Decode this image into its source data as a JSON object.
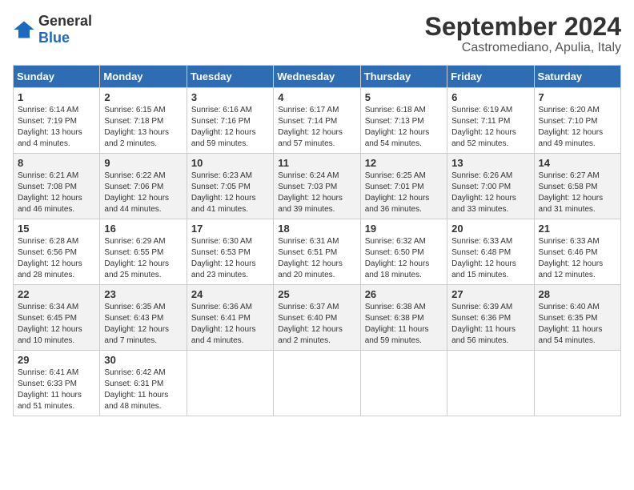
{
  "logo": {
    "general": "General",
    "blue": "Blue"
  },
  "header": {
    "month_year": "September 2024",
    "location": "Castromediano, Apulia, Italy"
  },
  "weekdays": [
    "Sunday",
    "Monday",
    "Tuesday",
    "Wednesday",
    "Thursday",
    "Friday",
    "Saturday"
  ],
  "days": [
    {
      "number": "1",
      "sunrise": "6:14 AM",
      "sunset": "7:19 PM",
      "daylight": "13 hours and 4 minutes."
    },
    {
      "number": "2",
      "sunrise": "6:15 AM",
      "sunset": "7:18 PM",
      "daylight": "13 hours and 2 minutes."
    },
    {
      "number": "3",
      "sunrise": "6:16 AM",
      "sunset": "7:16 PM",
      "daylight": "12 hours and 59 minutes."
    },
    {
      "number": "4",
      "sunrise": "6:17 AM",
      "sunset": "7:14 PM",
      "daylight": "12 hours and 57 minutes."
    },
    {
      "number": "5",
      "sunrise": "6:18 AM",
      "sunset": "7:13 PM",
      "daylight": "12 hours and 54 minutes."
    },
    {
      "number": "6",
      "sunrise": "6:19 AM",
      "sunset": "7:11 PM",
      "daylight": "12 hours and 52 minutes."
    },
    {
      "number": "7",
      "sunrise": "6:20 AM",
      "sunset": "7:10 PM",
      "daylight": "12 hours and 49 minutes."
    },
    {
      "number": "8",
      "sunrise": "6:21 AM",
      "sunset": "7:08 PM",
      "daylight": "12 hours and 46 minutes."
    },
    {
      "number": "9",
      "sunrise": "6:22 AM",
      "sunset": "7:06 PM",
      "daylight": "12 hours and 44 minutes."
    },
    {
      "number": "10",
      "sunrise": "6:23 AM",
      "sunset": "7:05 PM",
      "daylight": "12 hours and 41 minutes."
    },
    {
      "number": "11",
      "sunrise": "6:24 AM",
      "sunset": "7:03 PM",
      "daylight": "12 hours and 39 minutes."
    },
    {
      "number": "12",
      "sunrise": "6:25 AM",
      "sunset": "7:01 PM",
      "daylight": "12 hours and 36 minutes."
    },
    {
      "number": "13",
      "sunrise": "6:26 AM",
      "sunset": "7:00 PM",
      "daylight": "12 hours and 33 minutes."
    },
    {
      "number": "14",
      "sunrise": "6:27 AM",
      "sunset": "6:58 PM",
      "daylight": "12 hours and 31 minutes."
    },
    {
      "number": "15",
      "sunrise": "6:28 AM",
      "sunset": "6:56 PM",
      "daylight": "12 hours and 28 minutes."
    },
    {
      "number": "16",
      "sunrise": "6:29 AM",
      "sunset": "6:55 PM",
      "daylight": "12 hours and 25 minutes."
    },
    {
      "number": "17",
      "sunrise": "6:30 AM",
      "sunset": "6:53 PM",
      "daylight": "12 hours and 23 minutes."
    },
    {
      "number": "18",
      "sunrise": "6:31 AM",
      "sunset": "6:51 PM",
      "daylight": "12 hours and 20 minutes."
    },
    {
      "number": "19",
      "sunrise": "6:32 AM",
      "sunset": "6:50 PM",
      "daylight": "12 hours and 18 minutes."
    },
    {
      "number": "20",
      "sunrise": "6:33 AM",
      "sunset": "6:48 PM",
      "daylight": "12 hours and 15 minutes."
    },
    {
      "number": "21",
      "sunrise": "6:33 AM",
      "sunset": "6:46 PM",
      "daylight": "12 hours and 12 minutes."
    },
    {
      "number": "22",
      "sunrise": "6:34 AM",
      "sunset": "6:45 PM",
      "daylight": "12 hours and 10 minutes."
    },
    {
      "number": "23",
      "sunrise": "6:35 AM",
      "sunset": "6:43 PM",
      "daylight": "12 hours and 7 minutes."
    },
    {
      "number": "24",
      "sunrise": "6:36 AM",
      "sunset": "6:41 PM",
      "daylight": "12 hours and 4 minutes."
    },
    {
      "number": "25",
      "sunrise": "6:37 AM",
      "sunset": "6:40 PM",
      "daylight": "12 hours and 2 minutes."
    },
    {
      "number": "26",
      "sunrise": "6:38 AM",
      "sunset": "6:38 PM",
      "daylight": "11 hours and 59 minutes."
    },
    {
      "number": "27",
      "sunrise": "6:39 AM",
      "sunset": "6:36 PM",
      "daylight": "11 hours and 56 minutes."
    },
    {
      "number": "28",
      "sunrise": "6:40 AM",
      "sunset": "6:35 PM",
      "daylight": "11 hours and 54 minutes."
    },
    {
      "number": "29",
      "sunrise": "6:41 AM",
      "sunset": "6:33 PM",
      "daylight": "11 hours and 51 minutes."
    },
    {
      "number": "30",
      "sunrise": "6:42 AM",
      "sunset": "6:31 PM",
      "daylight": "11 hours and 48 minutes."
    }
  ],
  "labels": {
    "sunrise": "Sunrise:",
    "sunset": "Sunset:",
    "daylight": "Daylight:"
  }
}
